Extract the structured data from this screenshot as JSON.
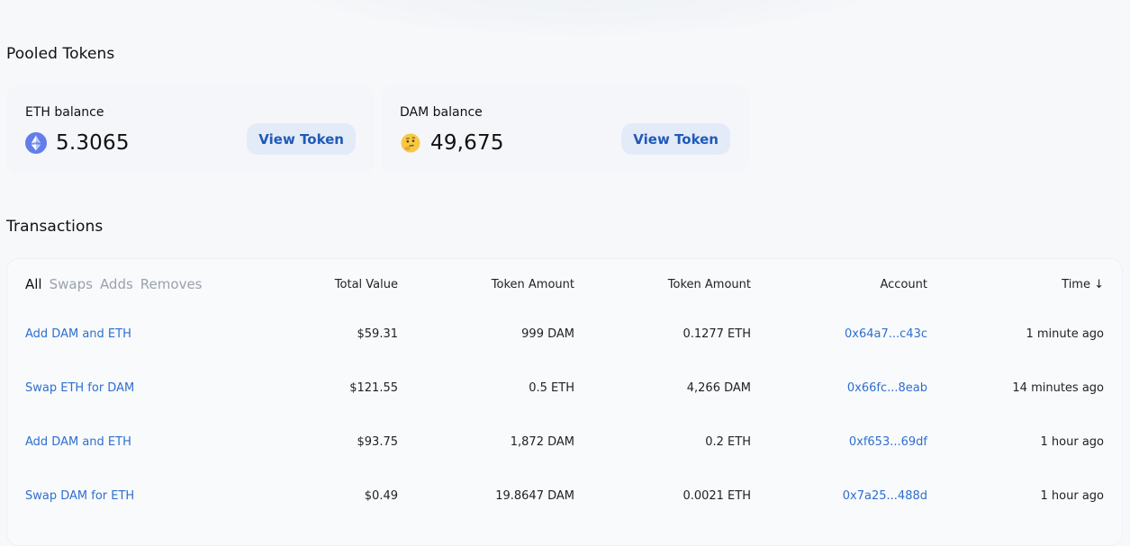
{
  "pooled": {
    "title": "Pooled Tokens",
    "cards": [
      {
        "label": "ETH balance",
        "amount": "5.3065",
        "icon": "ethereum-icon",
        "button": "View Token"
      },
      {
        "label": "DAM balance",
        "amount": "49,675",
        "icon": "thinking-face-icon",
        "button": "View Token"
      }
    ]
  },
  "transactions": {
    "title": "Transactions",
    "tabs": [
      "All",
      "Swaps",
      "Adds",
      "Removes"
    ],
    "active_tab": "All",
    "headers": {
      "total_value": "Total Value",
      "token_amount_1": "Token Amount",
      "token_amount_2": "Token Amount",
      "account": "Account",
      "time": "Time ↓"
    },
    "rows": [
      {
        "desc": "Add DAM and ETH",
        "total": "$59.31",
        "amt1": "999 DAM",
        "amt2": "0.1277 ETH",
        "account": "0x64a7...c43c",
        "time": "1 minute ago"
      },
      {
        "desc": "Swap ETH for DAM",
        "total": "$121.55",
        "amt1": "0.5 ETH",
        "amt2": "4,266 DAM",
        "account": "0x66fc...8eab",
        "time": "14 minutes ago"
      },
      {
        "desc": "Add DAM and ETH",
        "total": "$93.75",
        "amt1": "1,872 DAM",
        "amt2": "0.2 ETH",
        "account": "0xf653...69df",
        "time": "1 hour ago"
      },
      {
        "desc": "Swap DAM for ETH",
        "total": "$0.49",
        "amt1": "19.8647 DAM",
        "amt2": "0.0021 ETH",
        "account": "0x7a25...488d",
        "time": "1 hour ago"
      }
    ]
  },
  "colors": {
    "background": "#f7f8fa",
    "card": "#f4f6f9",
    "link": "#2e6fcf",
    "button_bg": "#e4ebf8",
    "button_text": "#1f5ab8",
    "eth_brand": "#627eea"
  }
}
